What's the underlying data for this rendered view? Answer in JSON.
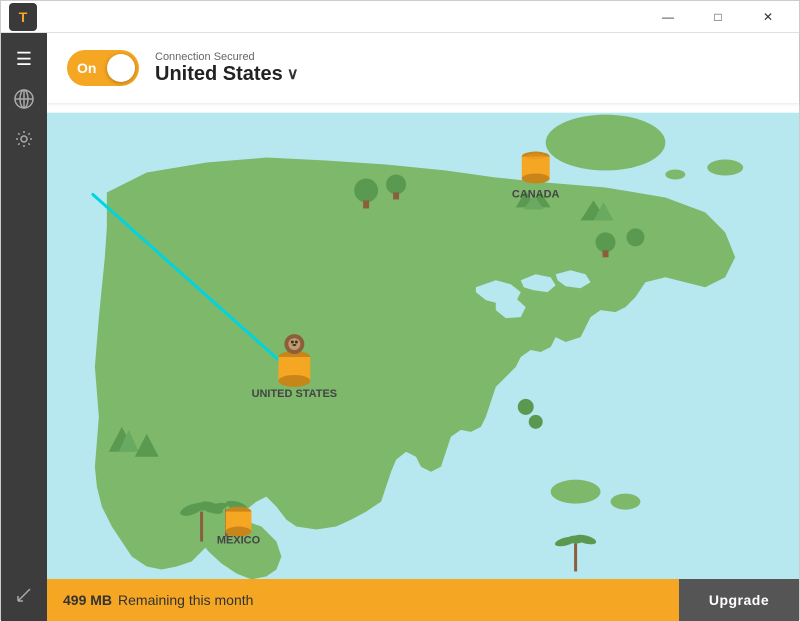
{
  "titlebar": {
    "logo": "T",
    "minimize_label": "—",
    "maximize_label": "□",
    "close_label": "✕"
  },
  "sidebar": {
    "menu_icon": "☰",
    "globe_icon": "🌐",
    "settings_icon": "⚙",
    "resize_icon": "↙"
  },
  "header": {
    "toggle_label": "On",
    "connection_status": "Connection Secured",
    "location": "United States",
    "chevron": "∨"
  },
  "map": {
    "connection_line_color": "#00d4e0",
    "canada_label": "CANADA",
    "us_label": "UNITED STATES",
    "mexico_label": "MEXICO",
    "ocean_color": "#b8e8ef",
    "land_color": "#7db86b",
    "dark_land_color": "#5a9a50"
  },
  "bottombar": {
    "remaining_mb": "499 MB",
    "remaining_text": "Remaining this month",
    "upgrade_label": "Upgrade"
  }
}
